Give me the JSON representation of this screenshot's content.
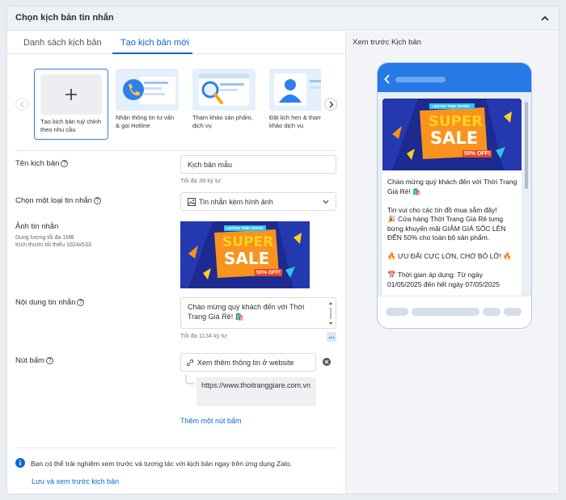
{
  "header": {
    "title": "Chọn kịch bản tin nhắn"
  },
  "tabs": [
    {
      "label": "Danh sách kịch bản"
    },
    {
      "label": "Tạo kịch bản mới"
    }
  ],
  "templates": [
    {
      "caption": "Tạo kịch bản tuỳ chỉnh theo nhu cầu",
      "icon": "plus-icon"
    },
    {
      "caption": "Nhận thông tin tư vấn & gọi Hotline",
      "icon": "phone-icon"
    },
    {
      "caption": "Tham khảo sản phẩm, dịch vụ",
      "icon": "magnifier-icon"
    },
    {
      "caption": "Đặt lịch hẹn & tham khảo dịch vụ",
      "icon": "person-icon"
    }
  ],
  "form": {
    "name_label": "Tên kịch bản",
    "name_value": "Kịch bản mẫu",
    "name_hint": "Tối đa 38 ký tự",
    "type_label": "Chọn một loại tin nhắn",
    "type_value": "Tin nhắn kèm hình ảnh",
    "image_label": "Ảnh tin nhắn",
    "image_sub1": "Dung lượng tối đa 1MB",
    "image_sub2": "Kích thước tối thiểu 1024x533",
    "content_label": "Nội dung tin nhắn",
    "content_value": "Chào mừng quý khách đến với Thời Trang Giá Rẻ! 🛍️",
    "content_hint": "Tối đa 1134 ký tự",
    "button_label": "Nút bấm",
    "button_text": "Xem thêm thông tin ở website",
    "button_url": "https://www.thoitranggiare.com.vn",
    "add_button": "Thêm một nút bấm"
  },
  "banner": {
    "limited": "LIMITED TIME OFFER",
    "super": "SUPER",
    "sale": "SALE",
    "off": "50% OFF!"
  },
  "info": {
    "text": "Bạn có thể trải nghiệm xem trước và tương tác với kịch bản ngay trên ứng dụng Zalo.",
    "link": "Lưu và xem trước kịch bản"
  },
  "preview": {
    "title": "Xem trước Kịch bản",
    "message": "Chào mừng quý khách đến với Thời Trang Giá Rẻ! 🛍️\n\nTin vui cho các tín đồ mua sắm đây!\n🎉 Cửa hàng Thời Trang Giá Rẻ tưng bừng khuyến mãi GIẢM GIÁ SỐC LÊN ĐẾN 50% cho toàn bộ sản phẩm.\n\n🔥 ƯU ĐÃI CỰC LỚN, CHỚ BỎ LỠ! 🔥\n\n📅 Thời gian áp dụng: Từ ngày 01/05/2025 đến hết ngày 07/05/2025"
  },
  "colors": {
    "accent": "#0b68d1",
    "phone_bar": "#2779e6",
    "sale_bg": "#1d2a8f",
    "sale_yellow": "#ffd21f",
    "sale_orange": "#f7931e"
  }
}
